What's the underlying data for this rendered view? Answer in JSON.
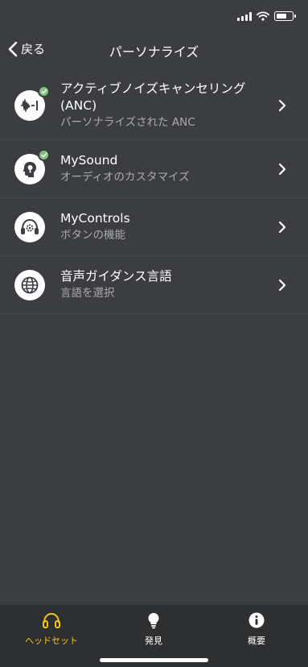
{
  "nav": {
    "back_label": "戻る",
    "title": "パーソナライズ"
  },
  "items": [
    {
      "title": "アクティブノイズキャンセリング (ANC)",
      "subtitle": "パーソナライズされた ANC",
      "icon": "anc-waveform-icon",
      "checked": true
    },
    {
      "title": "MySound",
      "subtitle": "オーディオのカスタマイズ",
      "icon": "head-sound-icon",
      "checked": true
    },
    {
      "title": "MyControls",
      "subtitle": "ボタンの機能",
      "icon": "headset-gear-icon",
      "checked": false
    },
    {
      "title": "音声ガイダンス言語",
      "subtitle": "言語を選択",
      "icon": "globe-icon",
      "checked": false
    }
  ],
  "tabs": [
    {
      "label": "ヘッドセット",
      "icon": "headphones-icon",
      "active": true
    },
    {
      "label": "発見",
      "icon": "lightbulb-icon",
      "active": false
    },
    {
      "label": "概要",
      "icon": "info-icon",
      "active": false
    }
  ],
  "colors": {
    "background": "#3c3d40",
    "tab_bar": "#2e2f31",
    "accent": "#f5c518",
    "check": "#7cc576",
    "subtitle": "#a9aaad"
  }
}
